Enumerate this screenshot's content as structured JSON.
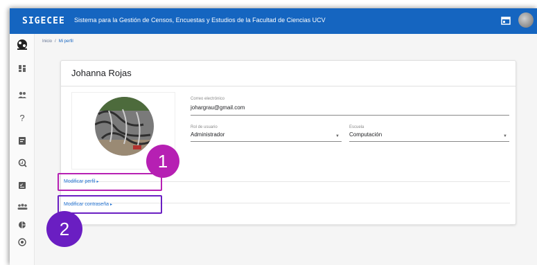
{
  "header": {
    "logo": "SIGECEE",
    "title": "Sistema para la Gestión de Censos, Encuestas y Estudios de la Facultad de Ciencias UCV",
    "icons": [
      "web-window-icon",
      "user-avatar"
    ]
  },
  "sidebar": {
    "items": [
      {
        "icon": "app-logo-icon"
      },
      {
        "icon": "dashboard-icon"
      },
      {
        "icon": "users-icon"
      },
      {
        "icon": "help-icon"
      },
      {
        "icon": "assignment-icon"
      },
      {
        "icon": "search-stats-icon"
      },
      {
        "icon": "checklist-icon"
      },
      {
        "icon": "groups-icon"
      },
      {
        "icon": "pie-chart-icon"
      },
      {
        "icon": "settings-circle-icon"
      }
    ]
  },
  "breadcrumb": {
    "home": "Inicio",
    "separator": "/",
    "current": "Mi perfil"
  },
  "profile": {
    "name": "Johanna Rojas",
    "email_label": "Correo electrónico",
    "email_value": "johargrau@gmail.com",
    "role_label": "Rol de usuario",
    "role_value": "Administrador",
    "school_label": "Escuela",
    "school_value": "Computación"
  },
  "actions": {
    "modify_profile": "Modificar perfil",
    "modify_password": "Modificar contraseña"
  },
  "annotations": {
    "badge1": "1",
    "badge2": "2",
    "badge1_color": "#b620b3",
    "badge2_color": "#6a1ec2",
    "box1_color": "#b620b3",
    "box2_color": "#6a1ec2"
  },
  "colors": {
    "topbar": "#1565c0",
    "link": "#1e6fd0"
  }
}
